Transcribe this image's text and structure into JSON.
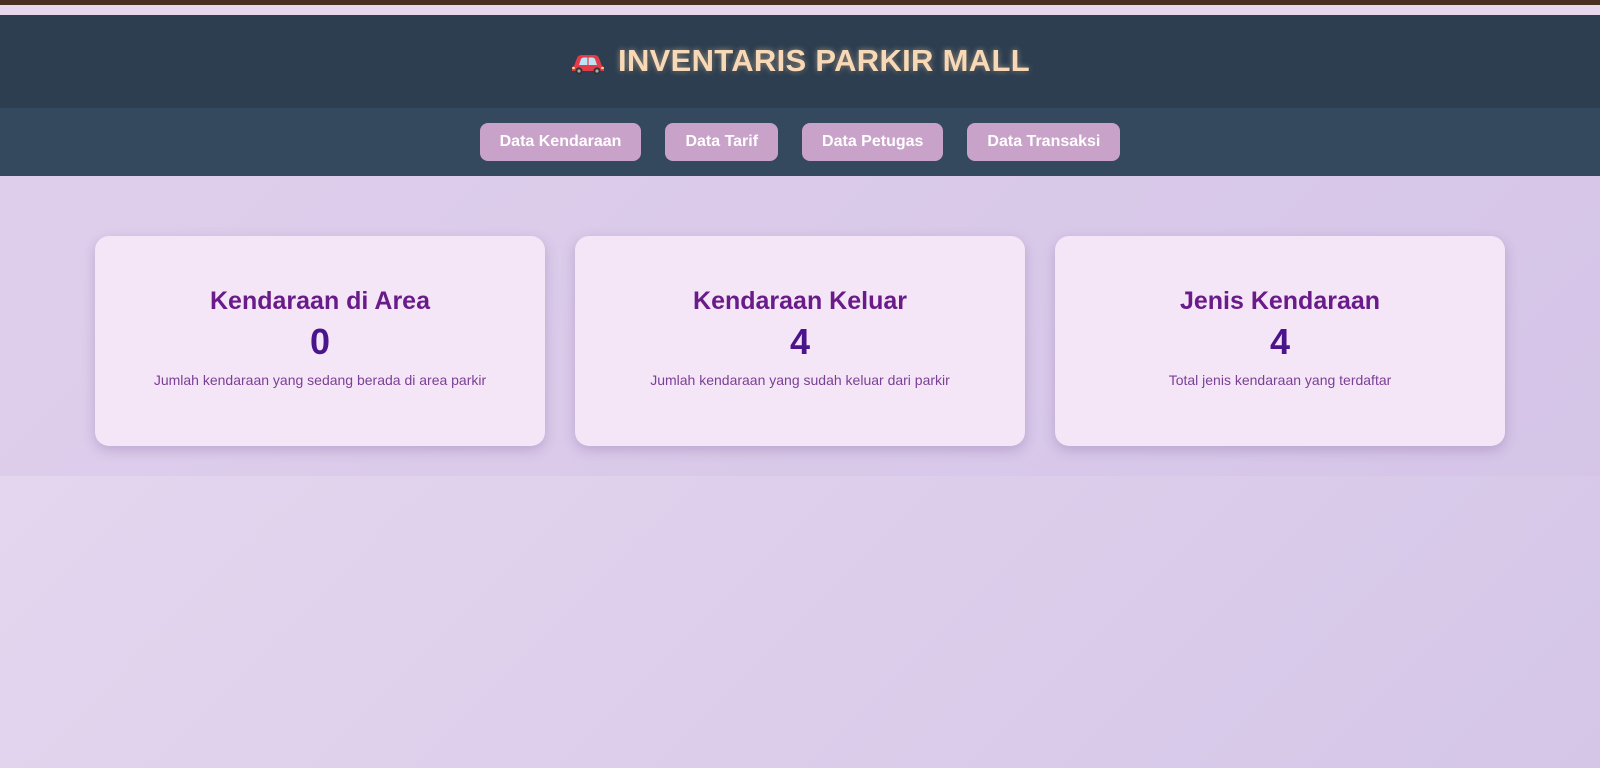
{
  "header": {
    "icon": "car-icon",
    "title": "INVENTARIS PARKIR MALL"
  },
  "nav": {
    "items": [
      {
        "label": "Data Kendaraan"
      },
      {
        "label": "Data Tarif"
      },
      {
        "label": "Data Petugas"
      },
      {
        "label": "Data Transaksi"
      }
    ]
  },
  "cards": [
    {
      "title": "Kendaraan di Area",
      "value": "0",
      "description": "Jumlah kendaraan yang sedang berada di area parkir"
    },
    {
      "title": "Kendaraan Keluar",
      "value": "4",
      "description": "Jumlah kendaraan yang sudah keluar dari parkir"
    },
    {
      "title": "Jenis Kendaraan",
      "value": "4",
      "description": "Total jenis kendaraan yang terdaftar"
    }
  ],
  "colors": {
    "header_bg": "#2c3e50",
    "nav_bg": "#34495e",
    "nav_button": "#c8a2c8",
    "title_text": "#f7d9b8",
    "card_bg": "#f5e6f7",
    "card_title": "#6a1b8a",
    "card_value": "#4a148c"
  }
}
